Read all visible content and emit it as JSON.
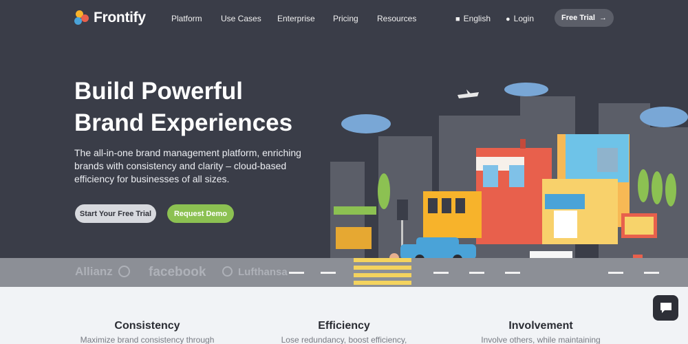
{
  "brand": {
    "name": "Frontify",
    "colors": {
      "hero_bg": "#3a3d48",
      "demo_green": "#8cc152"
    }
  },
  "nav": {
    "items": [
      "Platform",
      "Use Cases",
      "Enterprise",
      "Pricing",
      "Resources"
    ],
    "language": {
      "icon": "chat-bubble-icon",
      "label": "English"
    },
    "login": {
      "icon": "user-icon",
      "label": "Login"
    },
    "cta": {
      "label": "Free Trial",
      "icon": "arrow-right-icon"
    }
  },
  "hero": {
    "headline_line1": "Build Powerful",
    "headline_line2": "Brand Experiences",
    "subtext": "The all-in-one brand management platform, enriching brands with consistency and clarity – cloud-based efficiency for businesses of all sizes.",
    "primary_button": "Start Your Free Trial",
    "secondary_button": "Request Demo"
  },
  "clients": [
    "Allianz",
    "facebook",
    "Lufthansa"
  ],
  "features": [
    {
      "title": "Consistency",
      "text": "Maximize brand consistency through"
    },
    {
      "title": "Efficiency",
      "text": "Lose redundancy, boost efficiency,"
    },
    {
      "title": "Involvement",
      "text": "Involve others, while maintaining"
    }
  ],
  "chat": {
    "icon": "chat-icon"
  }
}
